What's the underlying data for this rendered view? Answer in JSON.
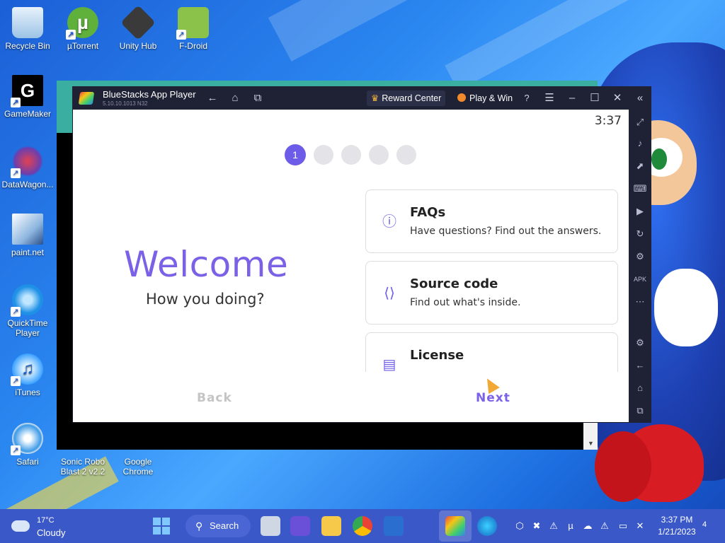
{
  "desktop": {
    "icons": [
      {
        "label": "Recycle Bin"
      },
      {
        "label": "µTorrent"
      },
      {
        "label": "Unity Hub"
      },
      {
        "label": "F-Droid"
      },
      {
        "label": "GameMaker"
      },
      {
        "label": "DataWagon..."
      },
      {
        "label": "paint.net"
      },
      {
        "label": "QuickTime Player"
      },
      {
        "label": "iTunes"
      },
      {
        "label": "Safari"
      },
      {
        "label": "Sonic Robo Blast 2 v2.2"
      },
      {
        "label": "Google Chrome"
      }
    ]
  },
  "bluestacks": {
    "title": "BlueStacks App Player",
    "version": "5.10.10.1013  N32",
    "reward_center": "Reward Center",
    "play_win": "Play & Win",
    "time": "3:37",
    "steps": [
      "1",
      "",
      "",
      "",
      ""
    ],
    "welcome": "Welcome",
    "subtitle": "How you doing?",
    "cards": [
      {
        "title": "FAQs",
        "desc": "Have questions? Find out the answers.",
        "icon": "question-circle-icon"
      },
      {
        "title": "Source code",
        "desc": "Find out what's inside.",
        "icon": "code-file-icon"
      },
      {
        "title": "License",
        "desc": "",
        "icon": "document-icon"
      }
    ],
    "back": "Back",
    "next": "Next"
  },
  "taskbar": {
    "temperature": "17°C",
    "condition": "Cloudy",
    "search": "Search",
    "time": "3:37 PM",
    "date": "1/21/2023",
    "notifications": "4"
  },
  "colors": {
    "accent": "#7b61e6",
    "taskbar": "#3b58c9",
    "titlebar": "#1f2235"
  }
}
